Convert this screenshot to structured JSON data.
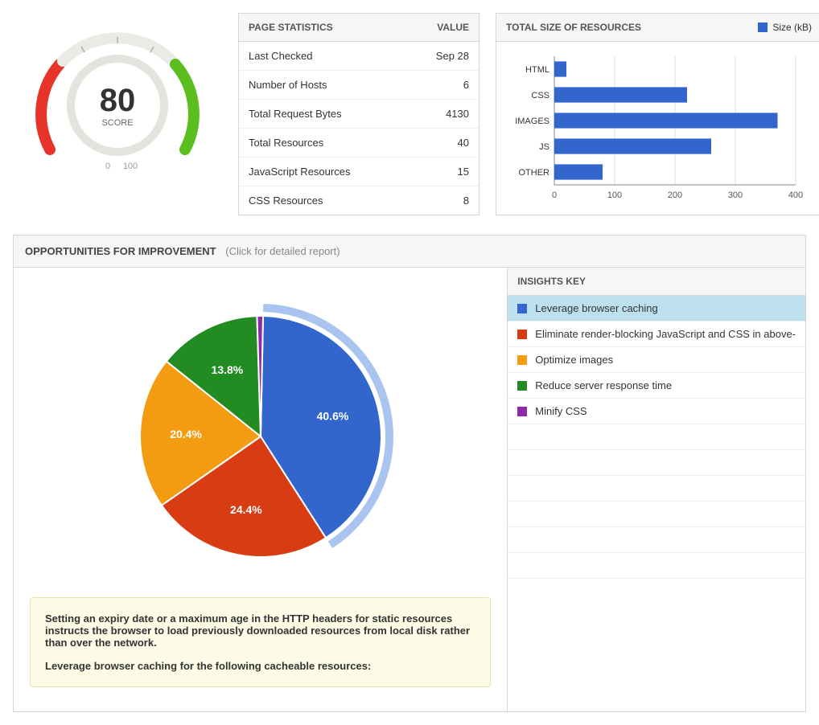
{
  "gauge": {
    "score": "80",
    "label": "SCORE",
    "min": "0",
    "max": "100"
  },
  "stats": {
    "header": "PAGE STATISTICS",
    "value_header": "VALUE",
    "rows": [
      {
        "name": "Last Checked",
        "value": "Sep 28"
      },
      {
        "name": "Number of Hosts",
        "value": "6"
      },
      {
        "name": "Total Request Bytes",
        "value": "4130"
      },
      {
        "name": "Total Resources",
        "value": "40"
      },
      {
        "name": "JavaScript Resources",
        "value": "15"
      },
      {
        "name": "CSS Resources",
        "value": "8"
      }
    ]
  },
  "bar": {
    "header": "TOTAL SIZE OF RESOURCES",
    "legend": "Size (kB)"
  },
  "improve": {
    "header": "OPPORTUNITIES FOR IMPROVEMENT",
    "sub": "(Click for detailed report)",
    "key_header": "INSIGHTS KEY",
    "items": [
      {
        "label": "Leverage browser caching",
        "color": "#3366cc",
        "selected": true
      },
      {
        "label": "Eliminate render-blocking JavaScript and CSS in above-",
        "color": "#d73c12",
        "selected": false
      },
      {
        "label": "Optimize images",
        "color": "#f39c12",
        "selected": false
      },
      {
        "label": "Reduce server response time",
        "color": "#228b22",
        "selected": false
      },
      {
        "label": "Minify CSS",
        "color": "#8e2aa8",
        "selected": false
      }
    ],
    "hint_main": "Setting an expiry date or a maximum age in the HTTP headers for static resources instructs the browser to load previously downloaded resources from local disk rather than over the network.",
    "hint_leverage": "Leverage browser caching for the following cacheable resources:"
  },
  "chart_data": [
    {
      "type": "bar",
      "orientation": "horizontal",
      "title": "TOTAL SIZE OF RESOURCES",
      "xlabel": "Size (kB)",
      "xlim": [
        0,
        400
      ],
      "categories": [
        "HTML",
        "CSS",
        "IMAGES",
        "JS",
        "OTHER"
      ],
      "values": [
        20,
        220,
        370,
        260,
        80
      ],
      "color": "#3366cc"
    },
    {
      "type": "pie",
      "title": "OPPORTUNITIES FOR IMPROVEMENT",
      "series": [
        {
          "name": "Leverage browser caching",
          "value": 40.6,
          "color": "#3366cc",
          "label": "40.6%"
        },
        {
          "name": "Eliminate render-blocking JavaScript and CSS in above-",
          "value": 24.4,
          "color": "#d73c12",
          "label": "24.4%"
        },
        {
          "name": "Optimize images",
          "value": 20.4,
          "color": "#f39c12",
          "label": "20.4%"
        },
        {
          "name": "Reduce server response time",
          "value": 13.8,
          "color": "#228b22",
          "label": "13.8%"
        },
        {
          "name": "Minify CSS",
          "value": 0.8,
          "color": "#8e2aa8",
          "label": ""
        }
      ],
      "highlight_index": 0
    },
    {
      "type": "gauge",
      "title": "SCORE",
      "value": 80,
      "min": 0,
      "max": 100
    }
  ]
}
